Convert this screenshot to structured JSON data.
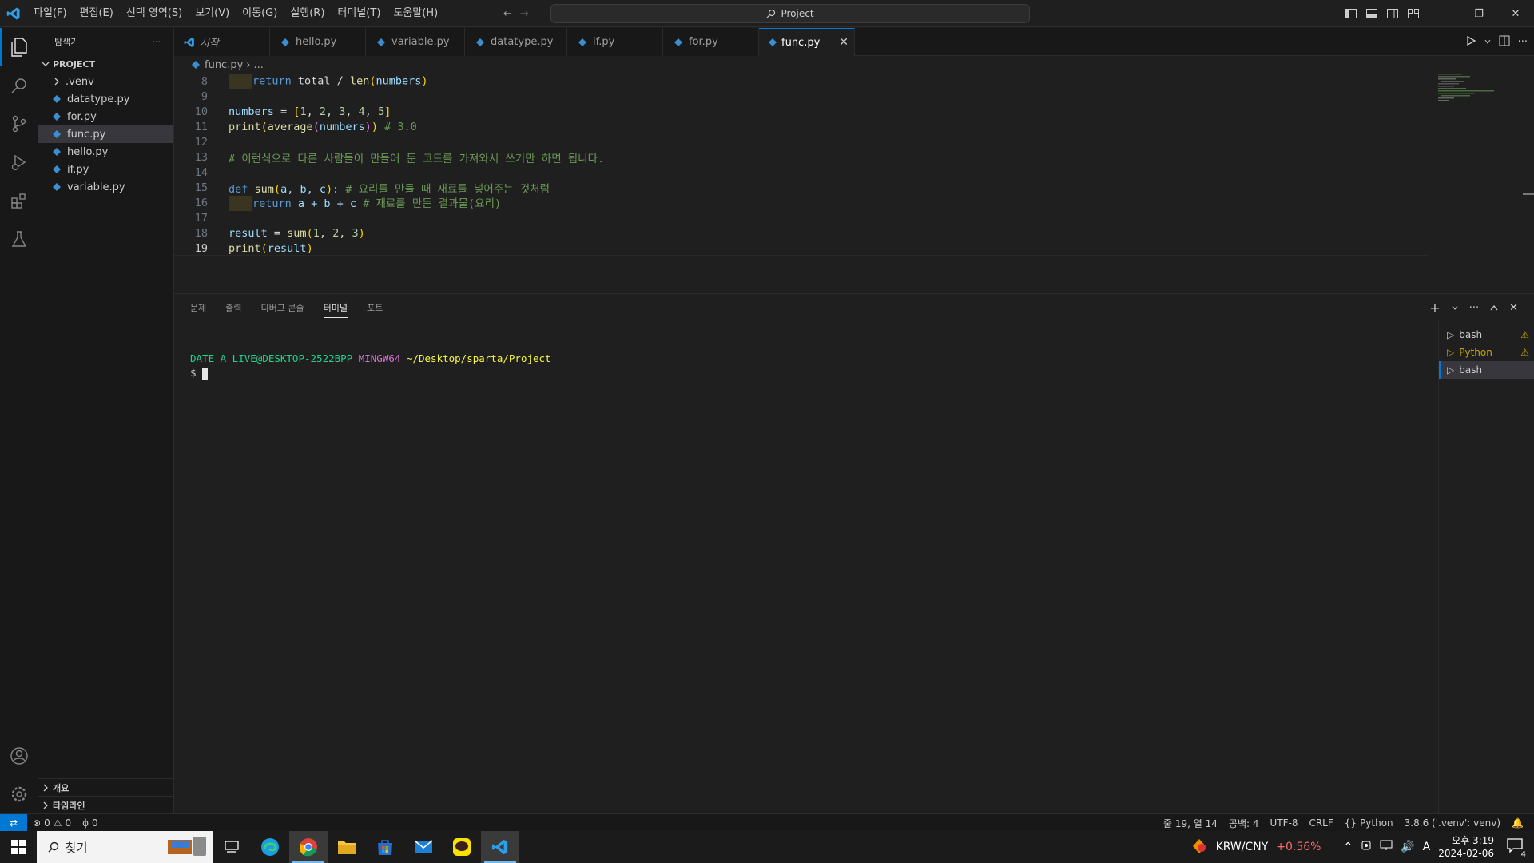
{
  "titlebar": {
    "menus": [
      "파일(F)",
      "편집(E)",
      "선택 영역(S)",
      "보기(V)",
      "이동(G)",
      "실행(R)",
      "터미널(T)",
      "도움말(H)"
    ],
    "search_text": "Project"
  },
  "sidebar": {
    "title": "탐색기",
    "more": "···",
    "project_label": "PROJECT",
    "folder": ".venv",
    "files": [
      "datatype.py",
      "for.py",
      "func.py",
      "hello.py",
      "if.py",
      "variable.py"
    ],
    "selected": "func.py",
    "outline_label": "개요",
    "timeline_label": "타임라인"
  },
  "tabs": {
    "start": "시작",
    "items": [
      "hello.py",
      "variable.py",
      "datatype.py",
      "if.py",
      "for.py"
    ],
    "active": "func.py"
  },
  "breadcrumb": {
    "file": "func.py",
    "rest": "..."
  },
  "editor": {
    "line_numbers": [
      "8",
      "9",
      "10",
      "11",
      "12",
      "13",
      "14",
      "15",
      "16",
      "17",
      "18",
      "19"
    ],
    "current_line": "19",
    "l8": {
      "kw": "return",
      "code": " total / ",
      "fn": "len",
      "arg": "numbers"
    },
    "l10": {
      "var": "numbers",
      "eq": " = ",
      "n1": "1",
      "n2": "2",
      "n3": "3",
      "n4": "4",
      "n5": "5"
    },
    "l11": {
      "fn1": "print",
      "fn2": "average",
      "arg": "numbers",
      "comment": "# 3.0"
    },
    "l13": {
      "comment": "# 이런식으로 다른 사람들이 만들어 둔 코드를 가져와서 쓰기만 하면 됩니다."
    },
    "l15": {
      "kw": "def",
      "fn": "sum",
      "params": "a, b, c",
      "comment": "# 요리를 만들 때 재료를 넣어주는 것처럼"
    },
    "l16": {
      "kw": "return",
      "expr": " a + b + c ",
      "comment": "# 재료를 만든 결과물(요리)"
    },
    "l18": {
      "var": "result",
      "fn": "sum",
      "n1": "1",
      "n2": "2",
      "n3": "3"
    },
    "l19": {
      "fn": "print",
      "arg": "result"
    }
  },
  "panel": {
    "tabs": [
      "문제",
      "출력",
      "디버그 콘솔",
      "터미널",
      "포트"
    ],
    "active_tab": "터미널",
    "terminal": {
      "user": "DATE A LIVE@DESKTOP-2522BPP",
      "mingw": "MINGW64",
      "path": "~/Desktop/sparta/Project",
      "prompt": "$"
    },
    "terminals": [
      "bash",
      "Python",
      "bash"
    ]
  },
  "statusbar": {
    "errors": "0",
    "warnings": "0",
    "ports": "0",
    "position": "줄 19, 열 14",
    "spaces": "공백: 4",
    "encoding": "UTF-8",
    "eol": "CRLF",
    "language": "Python",
    "interpreter": "3.8.6 ('.venv': venv)"
  },
  "taskbar": {
    "search_placeholder": "찾기",
    "ticker": "KRW/CNY",
    "ticker_change": "+0.56%",
    "ime": "A",
    "time": "오후 3:19",
    "date": "2024-02-06",
    "notifications": "4"
  },
  "colors": {
    "accent": "#0078d4",
    "statusbar_remote": "#0078d4",
    "warning": "#cca700",
    "ticker_change": "#ff6b6b"
  }
}
